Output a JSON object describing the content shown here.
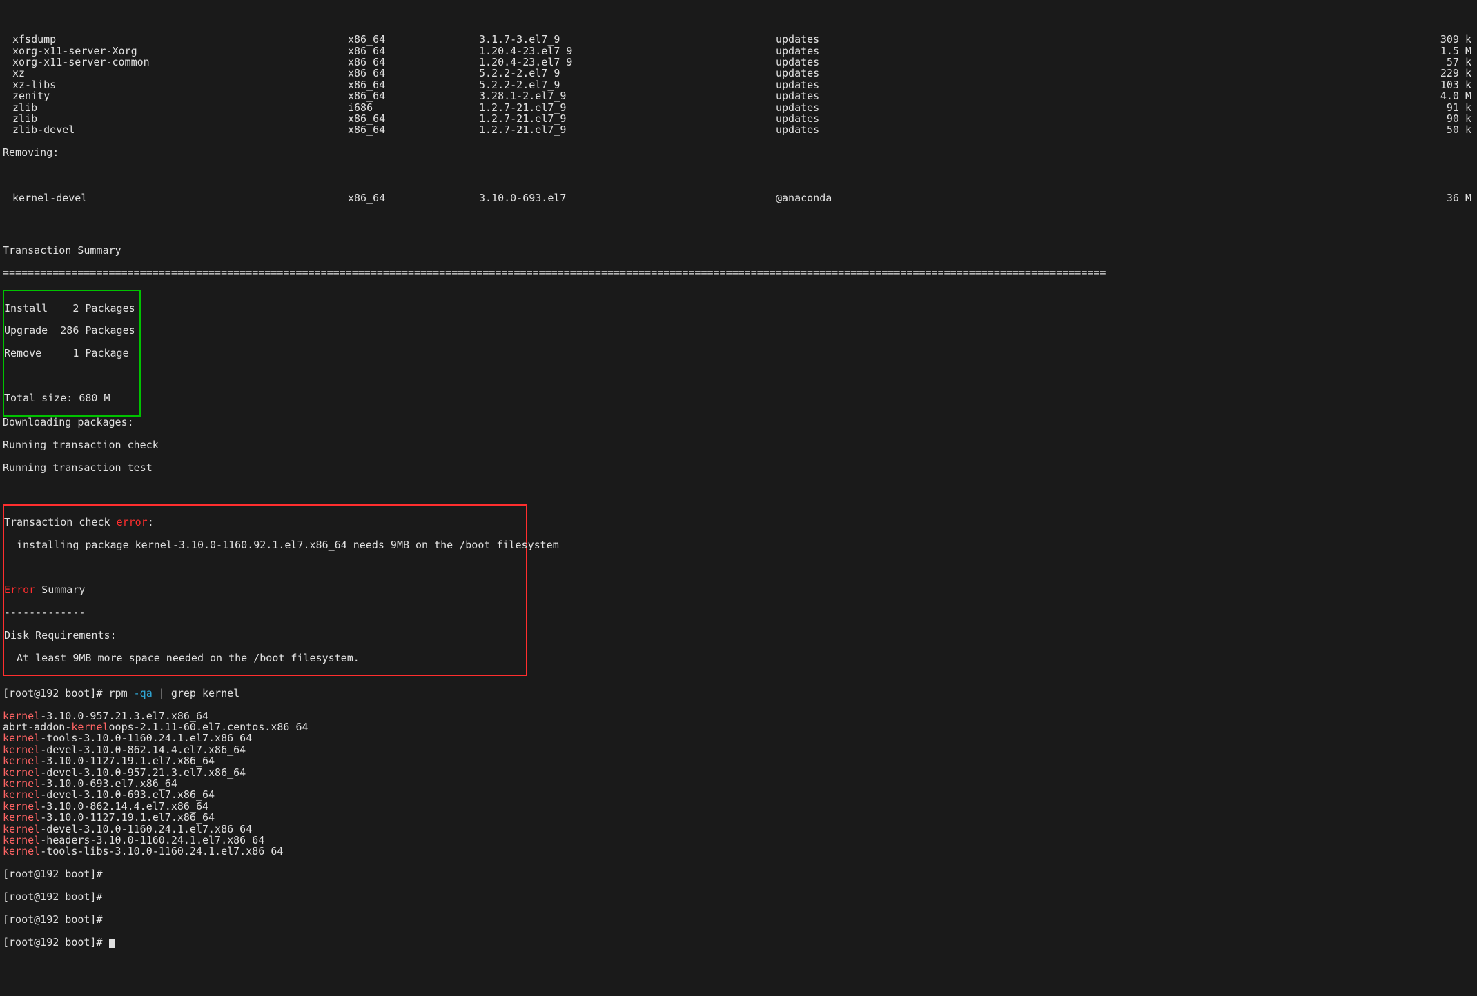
{
  "packages": [
    {
      "name": "xfsdump",
      "arch": "x86_64",
      "ver": "3.1.7-3.el7_9",
      "repo": "updates",
      "size": "309 k"
    },
    {
      "name": "xorg-x11-server-Xorg",
      "arch": "x86_64",
      "ver": "1.20.4-23.el7_9",
      "repo": "updates",
      "size": "1.5 M"
    },
    {
      "name": "xorg-x11-server-common",
      "arch": "x86_64",
      "ver": "1.20.4-23.el7_9",
      "repo": "updates",
      "size": "57 k"
    },
    {
      "name": "xz",
      "arch": "x86_64",
      "ver": "5.2.2-2.el7_9",
      "repo": "updates",
      "size": "229 k"
    },
    {
      "name": "xz-libs",
      "arch": "x86_64",
      "ver": "5.2.2-2.el7_9",
      "repo": "updates",
      "size": "103 k"
    },
    {
      "name": "zenity",
      "arch": "x86_64",
      "ver": "3.28.1-2.el7_9",
      "repo": "updates",
      "size": "4.0 M"
    },
    {
      "name": "zlib",
      "arch": "i686",
      "ver": "1.2.7-21.el7_9",
      "repo": "updates",
      "size": "91 k"
    },
    {
      "name": "zlib",
      "arch": "x86_64",
      "ver": "1.2.7-21.el7_9",
      "repo": "updates",
      "size": "90 k"
    },
    {
      "name": "zlib-devel",
      "arch": "x86_64",
      "ver": "1.2.7-21.el7_9",
      "repo": "updates",
      "size": "50 k"
    }
  ],
  "removing_header": "Removing:",
  "removing": {
    "name": "kernel-devel",
    "arch": "x86_64",
    "ver": "3.10.0-693.el7",
    "repo": "@anaconda",
    "size": "36 M"
  },
  "txn_summary_title": "Transaction Summary",
  "summary": {
    "l1": "Install    2 Packages",
    "l2": "Upgrade  286 Packages",
    "l3": "Remove     1 Package",
    "total": "Total size: 680 M"
  },
  "progress": {
    "l1": "Downloading packages:",
    "l2": "Running transaction check",
    "l3": "Running transaction test"
  },
  "error": {
    "head_prefix": "Transaction check ",
    "head_err": "error",
    "head_suffix": ":",
    "detail": "  installing package kernel-3.10.0-1160.92.1.el7.x86_64 needs 9MB on the /boot filesystem",
    "sum_err": "Error",
    "sum_rest": " Summary",
    "dashes": "-------------",
    "req": "Disk Requirements:",
    "req_body": "  At least 9MB more space needed on the /boot filesystem."
  },
  "prompt": {
    "text": "[root@192 boot]# ",
    "cmd_prefix": "rpm ",
    "cmd_opt": "-qa",
    "cmd_rest": " | grep kernel"
  },
  "rpms": [
    {
      "k": "kernel",
      "rest": "-3.10.0-957.21.3.el7.x86_64"
    },
    {
      "pre": "abrt-addon-",
      "k": "kernel",
      "rest": "oops-2.1.11-60.el7.centos.x86_64"
    },
    {
      "k": "kernel",
      "rest": "-tools-3.10.0-1160.24.1.el7.x86_64"
    },
    {
      "k": "kernel",
      "rest": "-devel-3.10.0-862.14.4.el7.x86_64"
    },
    {
      "k": "kernel",
      "rest": "-3.10.0-1127.19.1.el7.x86_64"
    },
    {
      "k": "kernel",
      "rest": "-devel-3.10.0-957.21.3.el7.x86_64"
    },
    {
      "k": "kernel",
      "rest": "-3.10.0-693.el7.x86_64"
    },
    {
      "k": "kernel",
      "rest": "-devel-3.10.0-693.el7.x86_64"
    },
    {
      "k": "kernel",
      "rest": "-3.10.0-862.14.4.el7.x86_64"
    },
    {
      "k": "kernel",
      "rest": "-3.10.0-1127.19.1.el7.x86_64"
    },
    {
      "k": "kernel",
      "rest": "-devel-3.10.0-1160.24.1.el7.x86_64"
    },
    {
      "k": "kernel",
      "rest": "-headers-3.10.0-1160.24.1.el7.x86_64"
    },
    {
      "k": "kernel",
      "rest": "-tools-libs-3.10.0-1160.24.1.el7.x86_64"
    }
  ],
  "divider": "================================================================================================================================================================================="
}
